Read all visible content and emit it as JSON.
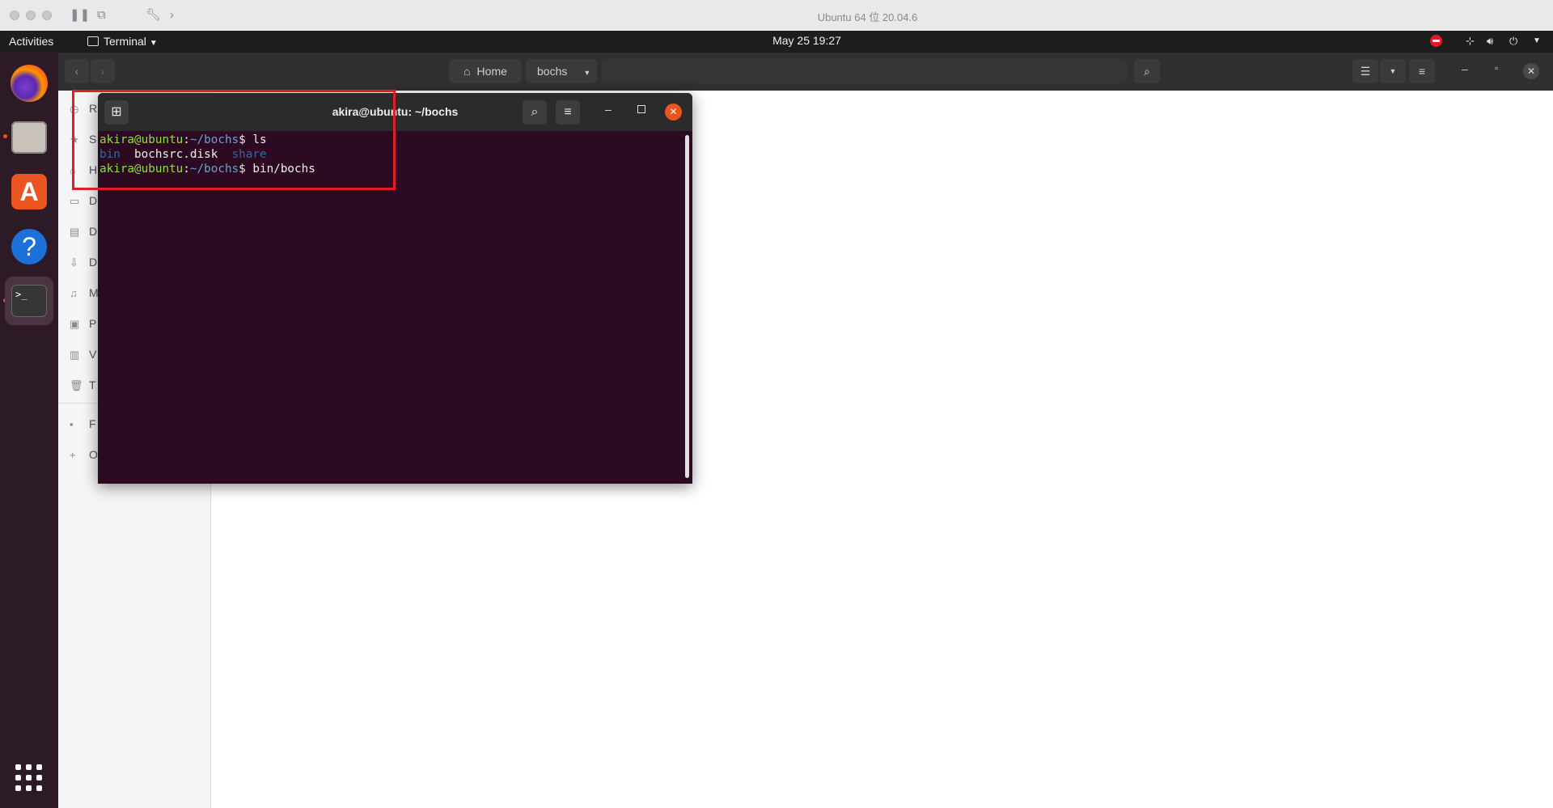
{
  "host": {
    "title": "Ubuntu 64 位 20.04.6"
  },
  "topbar": {
    "activities": "Activities",
    "app_menu": "Terminal",
    "clock": "May 25  19:27"
  },
  "dock": {
    "items": [
      "firefox-icon",
      "files-icon",
      "software-center-icon",
      "help-icon",
      "terminal-icon",
      "app-grid-icon"
    ]
  },
  "files": {
    "breadcrumb": {
      "home": "Home",
      "current": "bochs"
    },
    "sidebar": {
      "items": [
        "R",
        "S",
        "H",
        "D",
        "D",
        "D",
        "M",
        "P",
        "V",
        "T",
        "F",
        "O"
      ]
    }
  },
  "terminal": {
    "title": "akira@ubuntu: ~/bochs",
    "lines": [
      {
        "user": "akira@ubuntu",
        "sep": ":",
        "path": "~/bochs",
        "prompt": "$ ",
        "cmd": "ls"
      },
      {
        "dir1": "bin",
        "file": "  bochsrc.disk  ",
        "dir2": "share"
      },
      {
        "user": "akira@ubuntu",
        "sep": ":",
        "path": "~/bochs",
        "prompt": "$ ",
        "cmd": "bin/bochs"
      }
    ]
  },
  "colors": {
    "terminal_bg": "#2c0b22",
    "prompt_user": "#8ae234",
    "prompt_path": "#729fcf",
    "highlight_box": "#e11d2a",
    "ubuntu_orange": "#e95420"
  }
}
